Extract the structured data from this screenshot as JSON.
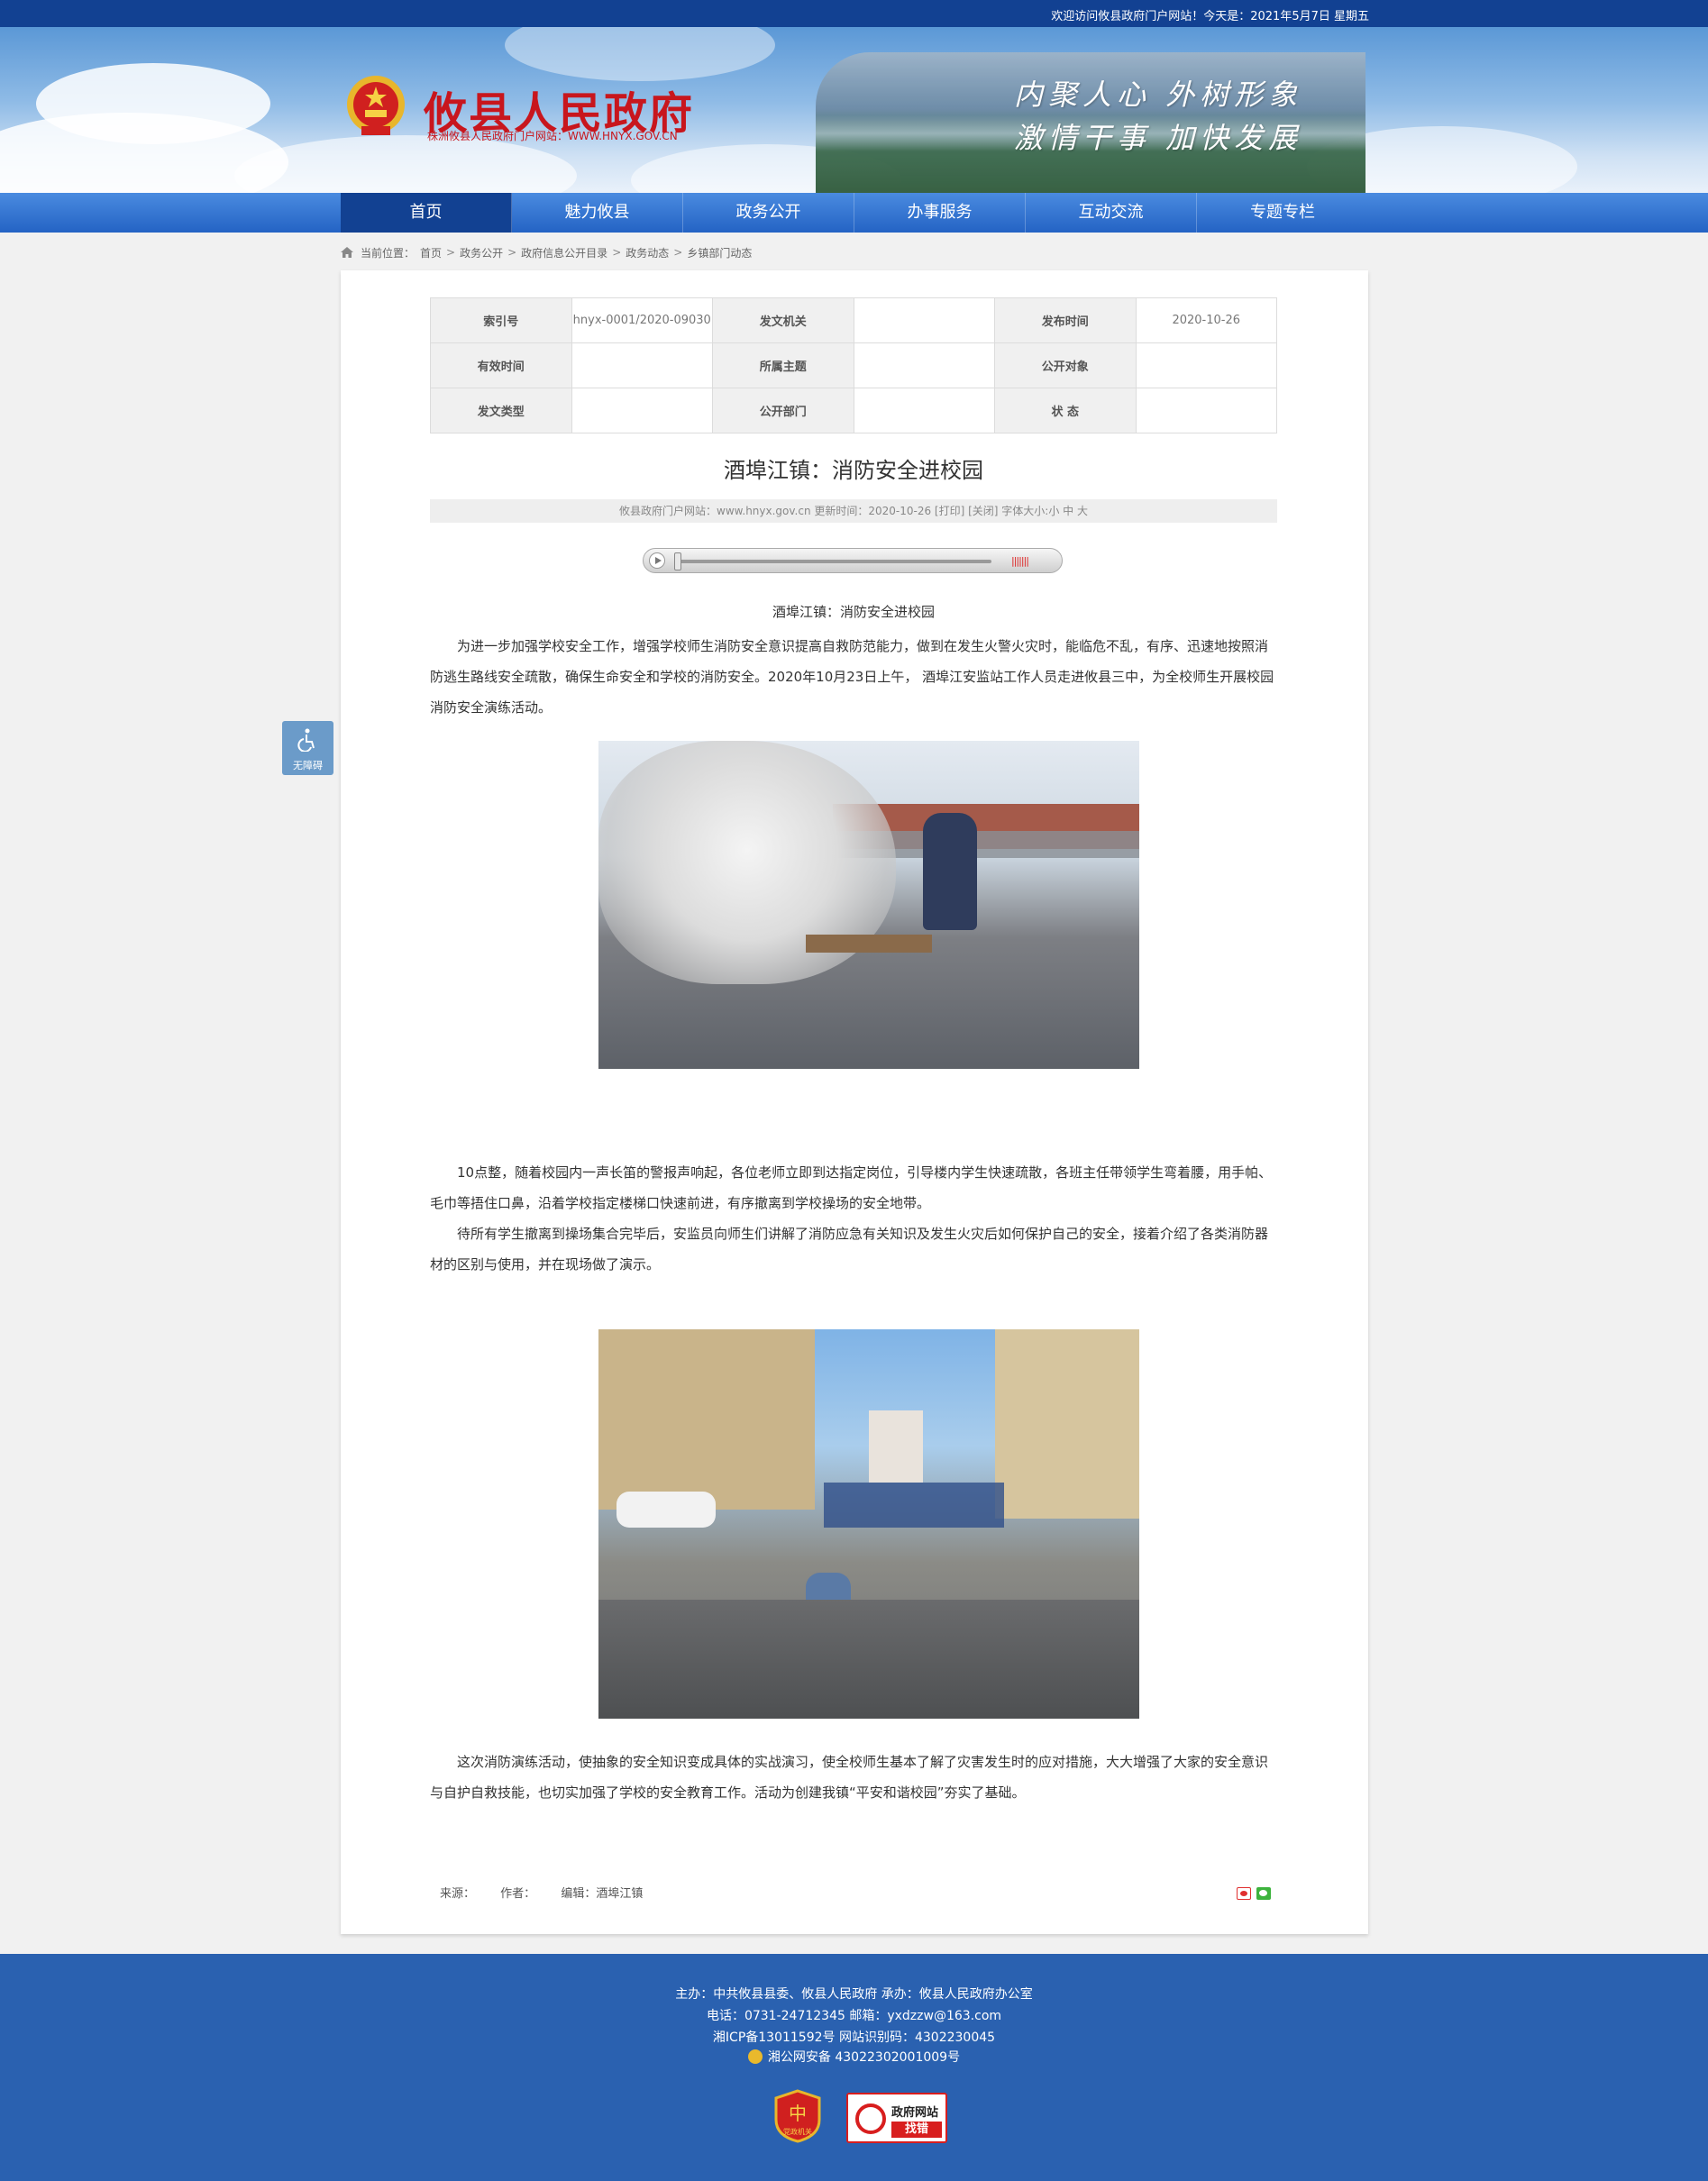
{
  "topbar": {
    "welcome": "欢迎访问攸县政府门户网站！今天是：2021年5月7日 星期五"
  },
  "header": {
    "site_title": "攸县人民政府",
    "site_subtitle": "株洲攸县人民政府门户网站：WWW.HNYX.GOV.CN",
    "slogan_line1": "内聚人心  外树形象",
    "slogan_line2": "激情干事  加快发展"
  },
  "nav": {
    "items": [
      {
        "label": "首页"
      },
      {
        "label": "魅力攸县"
      },
      {
        "label": "政务公开"
      },
      {
        "label": "办事服务"
      },
      {
        "label": "互动交流"
      },
      {
        "label": "专题专栏"
      }
    ]
  },
  "breadcrumb": {
    "prefix": "当前位置：",
    "items": [
      "首页",
      "政务公开",
      "政府信息公开目录",
      "政务动态",
      "乡镇部门动态"
    ],
    "separator": ">"
  },
  "meta": {
    "rows": [
      [
        {
          "label": "索引号",
          "value": "hnyx-0001/2020-09030"
        },
        {
          "label": "发文机关",
          "value": ""
        },
        {
          "label": "发布时间",
          "value": "2020-10-26"
        }
      ],
      [
        {
          "label": "有效时间",
          "value": ""
        },
        {
          "label": "所属主题",
          "value": ""
        },
        {
          "label": "公开对象",
          "value": ""
        }
      ],
      [
        {
          "label": "发文类型",
          "value": ""
        },
        {
          "label": "公开部门",
          "value": ""
        },
        {
          "label": "状 态",
          "value": ""
        }
      ]
    ]
  },
  "article": {
    "title": "酒埠江镇：消防安全进校园",
    "info": "攸县政府门户网站：www.hnyx.gov.cn   更新时间：2020-10-26  [打印] [关闭]  字体大小:小 中 大",
    "caption": "酒埠江镇：消防安全进校园",
    "para1": "为进一步加强学校安全工作，增强学校师生消防安全意识提高自救防范能力，做到在发生火警火灾时，能临危不乱，有序、迅速地按照消防逃生路线安全疏散，确保生命安全和学校的消防安全。2020年10月23日上午， 酒埠江安监站工作人员走进攸县三中，为全校师生开展校园消防安全演练活动。",
    "para2": "10点整，随着校园内一声长笛的警报声响起，各位老师立即到达指定岗位，引导楼内学生快速疏散，各班主任带领学生弯着腰，用手帕、毛巾等捂住口鼻，沿着学校指定楼梯口快速前进，有序撤离到学校操场的安全地带。",
    "para3": "待所有学生撤离到操场集合完毕后，安监员向师生们讲解了消防应急有关知识及发生火灾后如何保护自己的安全，接着介绍了各类消防器材的区别与使用，并在现场做了演示。",
    "para4": "这次消防演练活动，使抽象的安全知识变成具体的实战演习，使全校师生基本了解了灾害发生时的应对措施，大大增强了大家的安全意识与自护自救技能，也切实加强了学校的安全教育工作。活动为创建我镇“平安和谐校园”夯实了基础。"
  },
  "player": {
    "volume_marks": "|||||||"
  },
  "article_footer": {
    "source": "来源：",
    "author": "作者：",
    "editor": "编辑：酒埠江镇"
  },
  "accessibility": {
    "label": "无障碍"
  },
  "footer": {
    "line1": "主办：中共攸县县委、攸县人民政府 承办：攸县人民政府办公室",
    "line2": "电话：0731-24712345 邮箱：yxdzzw@163.com",
    "line3": "湘ICP备13011592号    网站识别码：4302230045",
    "line4": "湘公网安备 43022302001009号",
    "badge_party": "党政机关",
    "badge_find_1": "政府网站",
    "badge_find_2": "找错"
  },
  "colors": {
    "primary": "#2463c4",
    "dark_blue": "#124192",
    "footer_blue": "#2a61b0",
    "title_red": "#c8161d"
  }
}
